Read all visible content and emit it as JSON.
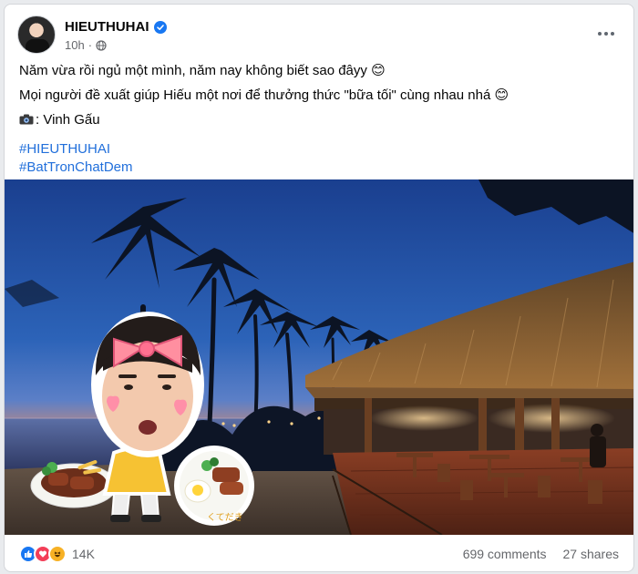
{
  "post": {
    "author": "HIEUTHUHAI",
    "time": "10h",
    "privacy_icon": "globe-icon",
    "lines": [
      "Năm vừa rồi ngủ một mình, năm nay không biết sao đâyy 😊",
      "Mọi người đề xuất giúp Hiếu một nơi để thưởng thức \"bữa tối\" cùng nhau nhá 😊",
      ": Vinh Gấu"
    ],
    "hashtags": [
      "#HIEUTHUHAI",
      "#BatTronChatDem"
    ],
    "sticker_text": "くてだき"
  },
  "stats": {
    "reaction_count": "14K",
    "reactions": [
      "like-icon",
      "love-icon",
      "haha-icon"
    ],
    "comments": "699 comments",
    "shares": "27 shares"
  },
  "colors": {
    "link": "#216fdb",
    "verified": "#1877f2"
  }
}
